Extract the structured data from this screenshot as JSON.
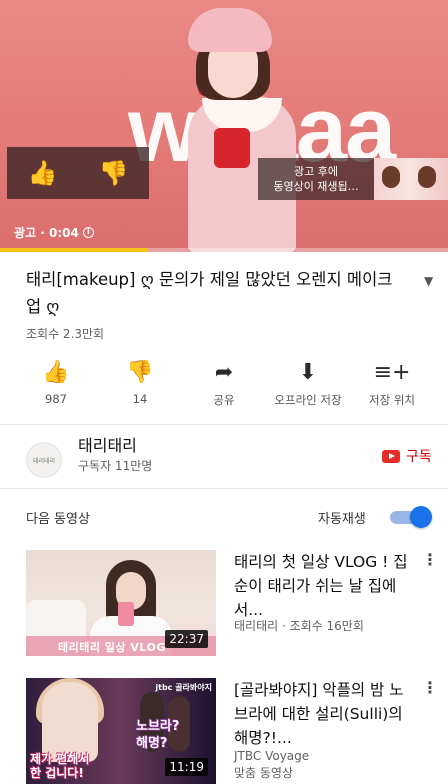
{
  "player": {
    "ad_word": "waaaa",
    "next_ad_text": "광고 후에\n동영상이 재생됩…",
    "ad_label": "광고 · 0:04",
    "info_glyph": "i",
    "progress_fraction": 0.33,
    "progress_color": "#f9c21b",
    "like_icon": "thumbs-up-icon",
    "dislike_icon": "thumbs-down-icon"
  },
  "video": {
    "title": "태리[makeup] ღ 문의가 제일 많았던 오렌지 메이크업 ღ",
    "views": "조회수 2.3만회"
  },
  "actions": [
    {
      "icon": "thumbs-up-icon",
      "glyph": "👍",
      "label": "987"
    },
    {
      "icon": "thumbs-down-icon",
      "glyph": "👎",
      "label": "14"
    },
    {
      "icon": "share-icon",
      "glyph": "➦",
      "label": "공유"
    },
    {
      "icon": "download-icon",
      "glyph": "⬇",
      "label": "오프라인 저장"
    },
    {
      "icon": "add-to-playlist-icon",
      "glyph": "≡+",
      "label": "저장 위치"
    }
  ],
  "channel": {
    "avatar_text": "태리태리",
    "name": "태리태리",
    "subscribers": "구독자 11만명",
    "subscribe_label": "구독",
    "accent": "#cc0000"
  },
  "upnext": {
    "label": "다음 동영상",
    "autoplay_label": "자동재생",
    "autoplay_on": true,
    "toggle_color": "#1a73e8"
  },
  "videos": [
    {
      "title": "태리의 첫 일상 VLOG ! 집순이 태리가 쉬는 날 집에서...",
      "meta_line1": "태리태리 · 조회수 16만회",
      "meta_line2": "",
      "duration": "22:37",
      "thumb_caption": "태리태리 일상 VLOG"
    },
    {
      "title": "[골라봐야지] 악플의 밤 노브라에 대한 설리(Sulli)의 해명?!...",
      "meta_line1": "JTBC Voyage",
      "meta_line2": "맞춤 동영상",
      "duration": "11:19",
      "thumb_caption": "제가 편해서\n한 겁니다!",
      "thumb_bubble": "노브라?\n해명?",
      "thumb_badge": "jtbc 골라봐야지"
    }
  ]
}
